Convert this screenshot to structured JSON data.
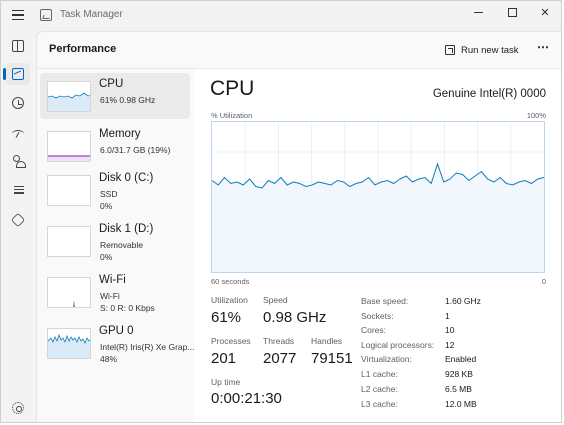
{
  "window": {
    "title": "Task Manager",
    "minimize_glyph": "",
    "close_glyph": "✕"
  },
  "nav": [
    {
      "name": "processes",
      "icon": "processes-icon"
    },
    {
      "name": "performance",
      "icon": "performance-icon",
      "active": true
    },
    {
      "name": "app-history",
      "icon": "history-icon"
    },
    {
      "name": "startup-apps",
      "icon": "startup-icon"
    },
    {
      "name": "users",
      "icon": "users-icon"
    },
    {
      "name": "details",
      "icon": "details-icon"
    },
    {
      "name": "services",
      "icon": "services-icon"
    },
    {
      "name": "settings",
      "icon": "gear-icon"
    }
  ],
  "header": {
    "title": "Performance",
    "run_new_task": "Run new task",
    "more": "⋯"
  },
  "devices": [
    {
      "name": "CPU",
      "sub1": "61%  0.98 GHz",
      "sub2": "",
      "sub3": ""
    },
    {
      "name": "Memory",
      "sub1": "6.0/31.7 GB (19%)",
      "sub2": "",
      "sub3": ""
    },
    {
      "name": "Disk 0 (C:)",
      "sub1": "SSD",
      "sub2": "0%",
      "sub3": ""
    },
    {
      "name": "Disk 1 (D:)",
      "sub1": "Removable",
      "sub2": "0%",
      "sub3": ""
    },
    {
      "name": "Wi-Fi",
      "sub1": "Wi-Fi",
      "sub2": "S: 0  R: 0 Kbps",
      "sub3": ""
    },
    {
      "name": "GPU 0",
      "sub1": "Intel(R) Iris(R) Xe Grap...",
      "sub2": "48%",
      "sub3": ""
    }
  ],
  "cpu": {
    "title": "CPU",
    "model": "Genuine Intel(R) 0000",
    "graph": {
      "y_label": "% Utilization",
      "y_max_label": "100%",
      "x_left_label": "60 seconds",
      "x_right_label": "0",
      "utilization_percent": [
        61,
        58,
        63,
        59,
        60,
        58,
        62,
        57,
        56,
        61,
        59,
        63,
        58,
        60,
        59,
        57,
        58,
        60,
        59,
        58,
        61,
        60,
        57,
        59,
        60,
        63,
        58,
        60,
        61,
        59,
        62,
        64,
        60,
        62,
        63,
        59,
        72,
        60,
        62,
        66,
        65,
        61,
        64,
        67,
        62,
        60,
        63,
        59,
        58,
        60,
        61,
        59,
        62,
        63
      ]
    },
    "stats": {
      "utilization_label": "Utilization",
      "utilization": "61%",
      "speed_label": "Speed",
      "speed": "0.98 GHz",
      "processes_label": "Processes",
      "processes": "201",
      "threads_label": "Threads",
      "threads": "2077",
      "handles_label": "Handles",
      "handles": "79151",
      "uptime_label": "Up time",
      "uptime": "0:00:21:30"
    },
    "specs": [
      {
        "label": "Base speed:",
        "value": "1.60 GHz"
      },
      {
        "label": "Sockets:",
        "value": "1"
      },
      {
        "label": "Cores:",
        "value": "10"
      },
      {
        "label": "Logical processors:",
        "value": "12"
      },
      {
        "label": "Virtualization:",
        "value": "Enabled"
      },
      {
        "label": "L1 cache:",
        "value": "928 KB"
      },
      {
        "label": "L2 cache:",
        "value": "6.5 MB"
      },
      {
        "label": "L3 cache:",
        "value": "12.0 MB"
      }
    ]
  },
  "colors": {
    "cpu": "#117dbb",
    "memory": "#8b12ae",
    "disk": "#4da60c",
    "wifi": "#a74f01",
    "gpu": "#117dbb",
    "accent": "#0067c0"
  }
}
